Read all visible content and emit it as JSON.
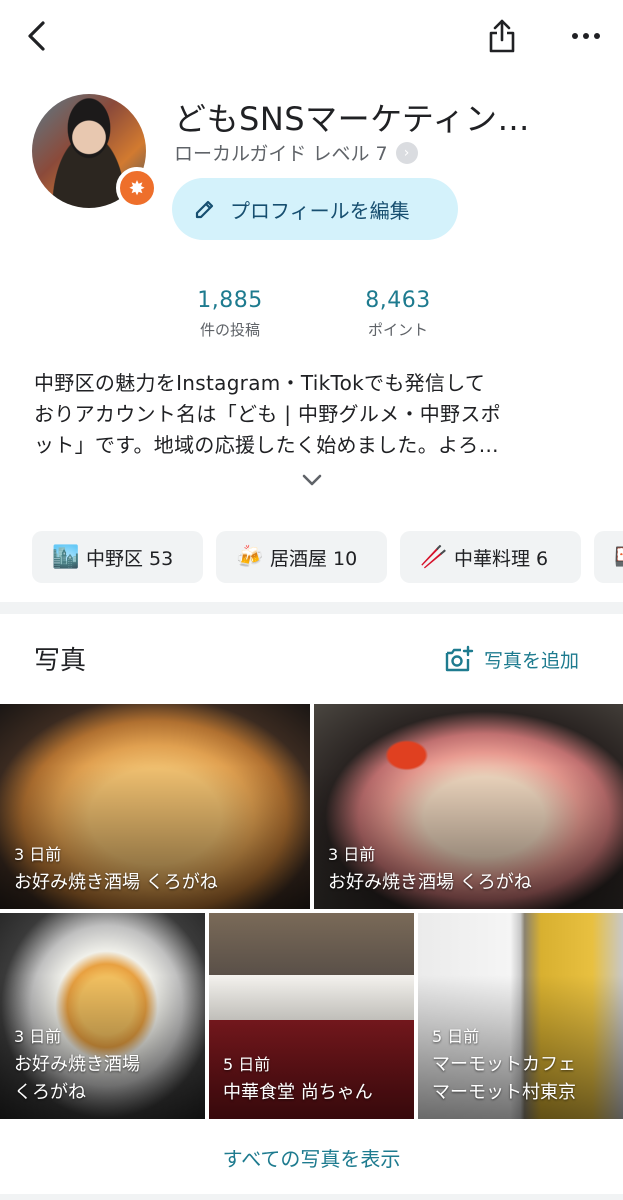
{
  "topbar": {
    "back_icon": "chevron-left-icon",
    "share_icon": "share-icon",
    "more_icon": "more-horizontal-icon"
  },
  "profile": {
    "name": "どもSNSマーケティン…",
    "guide_level": "ローカルガイド レベル 7",
    "edit_label": "プロフィールを編集",
    "badge_color": "#ee6f2b"
  },
  "stats": [
    {
      "value": "1,885",
      "label": "件の投稿"
    },
    {
      "value": "8,463",
      "label": "ポイント"
    }
  ],
  "bio": {
    "lines": [
      "中野区の魅力をInstagram・TikTokでも発信して",
      "おりアカウント名は「ども | 中野グルメ・中野スポ",
      "ット」です。地域の応援したく始めました。よろ…"
    ]
  },
  "chips": [
    {
      "icon": "🏙️",
      "label": "中野区 53"
    },
    {
      "icon": "🍻",
      "label": "居酒屋 10"
    },
    {
      "icon": "🥢",
      "label": "中華料理 6"
    },
    {
      "icon": "🍱",
      "label": ""
    }
  ],
  "photos_section": {
    "title": "写真",
    "add_label": "写真を追加",
    "show_all": "すべての写真を表示"
  },
  "photos": [
    {
      "date": "3 日前",
      "place_line1": "お好み焼き酒場 くろがね",
      "place_line2": ""
    },
    {
      "date": "3 日前",
      "place_line1": "お好み焼き酒場 くろがね",
      "place_line2": ""
    },
    {
      "date": "3 日前",
      "place_line1": "お好み焼き酒場",
      "place_line2": "くろがね"
    },
    {
      "date": "5 日前",
      "place_line1": "中華食堂 尚ちゃん",
      "place_line2": ""
    },
    {
      "date": "5 日前",
      "place_line1": "マーモットカフェ",
      "place_line2": "マーモット村東京"
    }
  ],
  "colors": {
    "accent": "#1e7b8f",
    "edit_button_bg": "#d4f2fb",
    "chip_bg": "#f1f3f4"
  }
}
